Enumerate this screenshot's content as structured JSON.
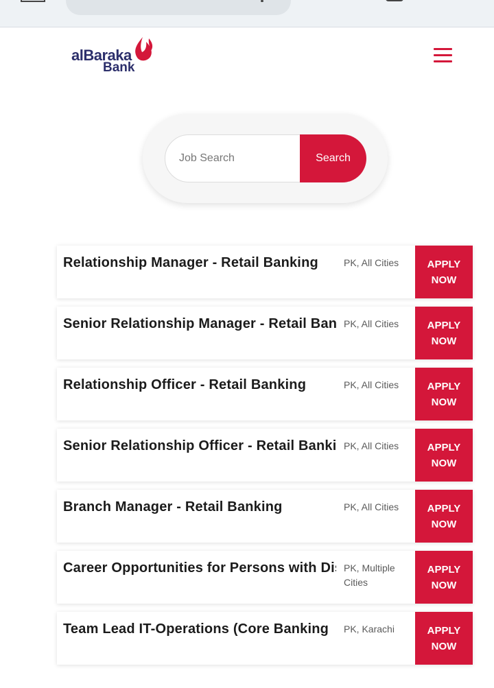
{
  "header": {
    "logo": {
      "line1": "alBaraka",
      "line2": "Bank",
      "brand_color": "#d4173a",
      "text_color": "#2c2f6b"
    },
    "menu_icon": "hamburger-menu-icon"
  },
  "search": {
    "placeholder": "Job Search",
    "value": "",
    "button_label": "Search"
  },
  "jobs": [
    {
      "title": "Relationship Manager - Retail Banking",
      "location": "PK, All Cities",
      "apply_label": "APPLY NOW"
    },
    {
      "title": "Senior Relationship Manager - Retail Banking",
      "location": "PK, All Cities",
      "apply_label": "APPLY NOW"
    },
    {
      "title": "Relationship Officer - Retail Banking",
      "location": "PK, All Cities",
      "apply_label": "APPLY NOW"
    },
    {
      "title": "Senior Relationship Officer - Retail Banking",
      "location": "PK, All Cities",
      "apply_label": "APPLY NOW"
    },
    {
      "title": "Branch Manager - Retail Banking",
      "location": "PK, All Cities",
      "apply_label": "APPLY NOW"
    },
    {
      "title": "Career Opportunities for Persons with Disabilities",
      "location": "PK, Multiple Cities",
      "apply_label": "APPLY NOW"
    },
    {
      "title": "Team Lead IT-Operations (Core Banking",
      "location": "PK, Karachi",
      "apply_label": "APPLY NOW"
    }
  ],
  "colors": {
    "accent": "#d4173a",
    "card_bg": "#ffffff",
    "search_shell_bg": "#f6f6f6"
  }
}
